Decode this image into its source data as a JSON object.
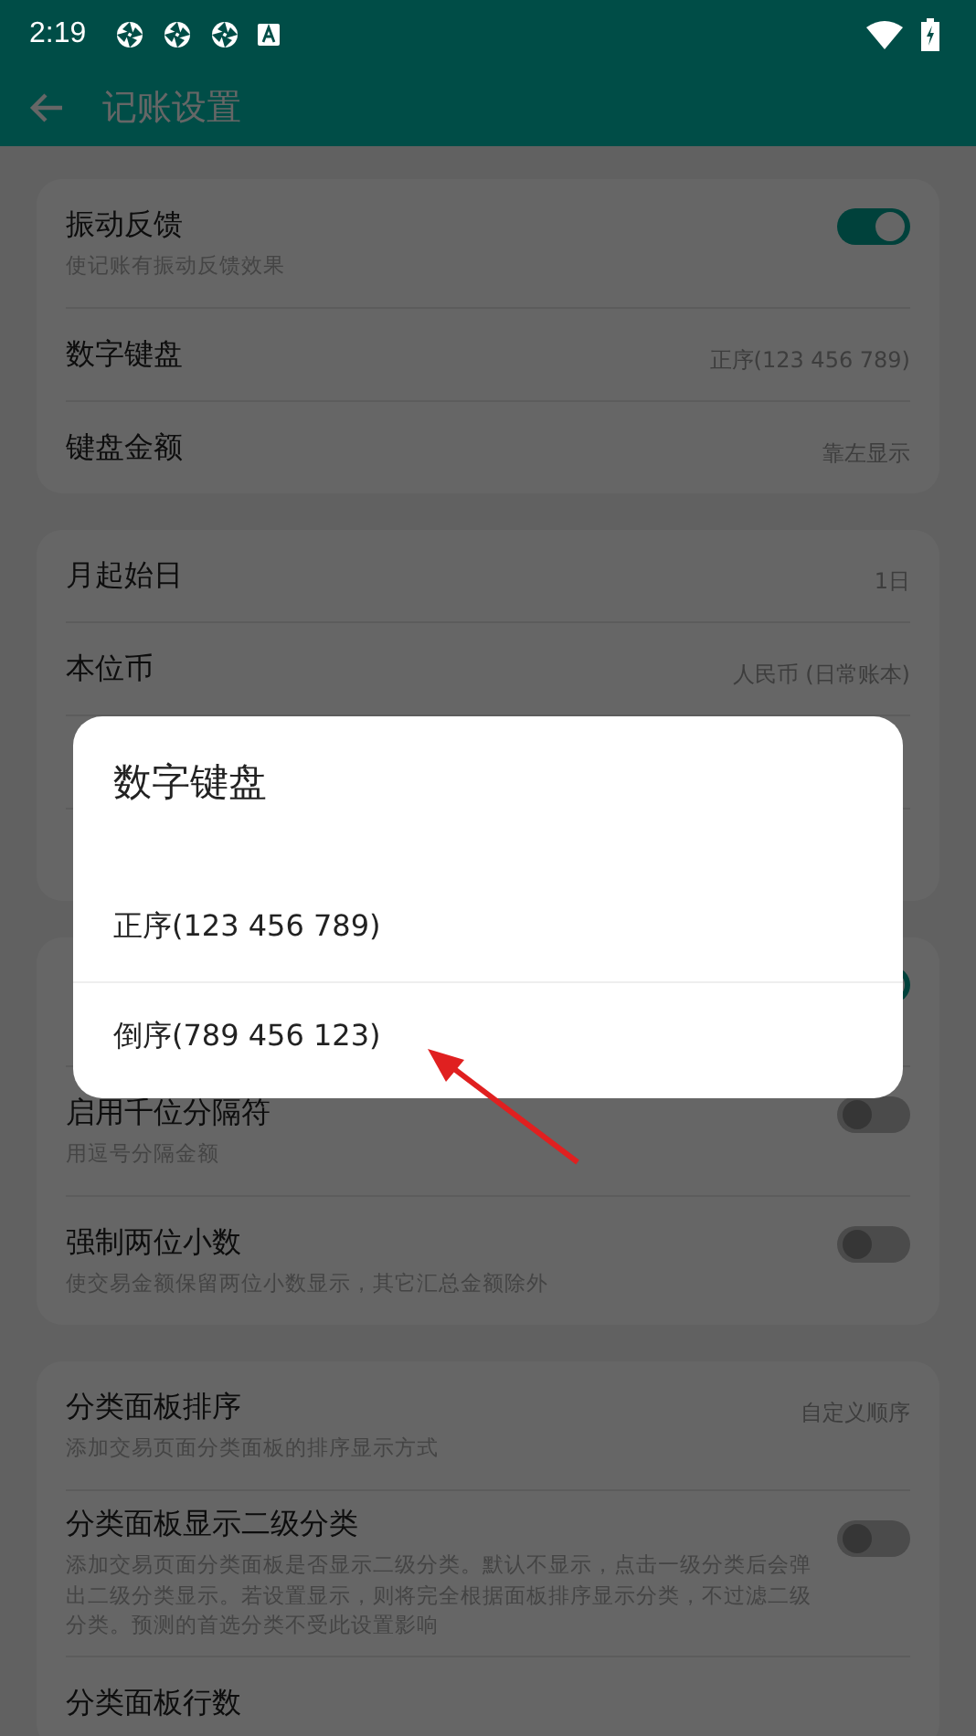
{
  "status_bar": {
    "time": "2:19"
  },
  "toolbar": {
    "title": "记账设置"
  },
  "groups": [
    {
      "rows": [
        {
          "kind": "toggle",
          "title": "振动反馈",
          "subtitle": "使记账有振动反馈效果",
          "on": true
        },
        {
          "kind": "value",
          "title": "数字键盘",
          "value": "正序(123 456 789)"
        },
        {
          "kind": "value",
          "title": "键盘金额",
          "value": "靠左显示"
        }
      ]
    },
    {
      "rows": [
        {
          "kind": "value",
          "title": "月起始日",
          "value": "1日"
        },
        {
          "kind": "value",
          "title": "本位币",
          "value": "人民币 (日常账本)"
        },
        {
          "kind": "hidden"
        },
        {
          "kind": "hidden"
        }
      ]
    },
    {
      "rows": [
        {
          "kind": "toggle",
          "on": true
        },
        {
          "kind": "toggle",
          "title": "启用千位分隔符",
          "subtitle": "用逗号分隔金额",
          "on": false
        },
        {
          "kind": "toggle",
          "title": "强制两位小数",
          "subtitle": "使交易金额保留两位小数显示，其它汇总金额除外",
          "on": false
        }
      ]
    },
    {
      "rows": [
        {
          "kind": "value",
          "title": "分类面板排序",
          "subtitle": "添加交易页面分类面板的排序显示方式",
          "value": "自定义顺序"
        },
        {
          "kind": "toggle",
          "title": "分类面板显示二级分类",
          "subtitle": "添加交易页面分类面板是否显示二级分类。默认不显示，点击一级分类后会弹出二级分类显示。若设置显示，则将完全根据面板排序显示分类，不过滤二级分类。预测的首选分类不受此设置影响",
          "on": false
        },
        {
          "kind": "value",
          "title": "分类面板行数"
        }
      ]
    }
  ],
  "dialog": {
    "title": "数字键盘",
    "options": [
      {
        "label": "正序(123 456 789)"
      },
      {
        "label": "倒序(789 456 123)"
      }
    ]
  }
}
